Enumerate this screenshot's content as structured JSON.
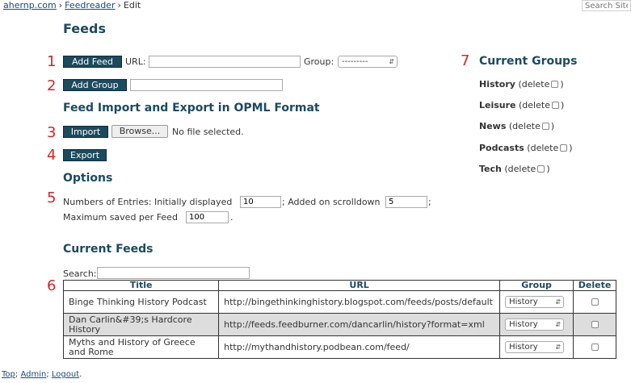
{
  "breadcrumb": {
    "site": "ahernp.com",
    "section": "Feedreader",
    "current": "Edit",
    "separator": "›"
  },
  "site_search": {
    "placeholder": "Search Site"
  },
  "page_title": "Feeds",
  "callouts": [
    "1",
    "2",
    "3",
    "4",
    "5",
    "6",
    "7"
  ],
  "add_feed": {
    "button": "Add Feed",
    "url_label": "URL:",
    "url_value": "",
    "group_label": "Group:",
    "group_value": "---------"
  },
  "add_group": {
    "button": "Add Group",
    "value": ""
  },
  "opml": {
    "heading": "Feed Import and Export in OPML Format",
    "import_button": "Import",
    "browse_button": "Browse...",
    "file_status": "No file selected.",
    "export_button": "Export"
  },
  "options": {
    "heading": "Options",
    "entries_label": "Numbers of Entries: Initially displayed",
    "initial_value": "10",
    "scroll_label": "; Added on scrolldown",
    "scroll_value": "5",
    "scroll_suffix": ";",
    "max_label": "Maximum saved per Feed",
    "max_value": "100",
    "max_suffix": "."
  },
  "current_feeds": {
    "heading": "Current Feeds",
    "search_label": "Search:",
    "search_value": "",
    "columns": [
      "Title",
      "URL",
      "Group",
      "Delete"
    ],
    "rows": [
      {
        "title": "Binge Thinking History Podcast",
        "url": "http://bingethinkinghistory.blogspot.com/feeds/posts/default",
        "group": "History"
      },
      {
        "title": "Dan Carlin&#39;s Hardcore History",
        "url": "http://feeds.feedburner.com/dancarlin/history?format=xml",
        "group": "History"
      },
      {
        "title": "Myths and History of Greece and Rome",
        "url": "http://mythandhistory.podbean.com/feed/",
        "group": "History"
      }
    ]
  },
  "current_groups": {
    "heading": "Current Groups",
    "delete_label": "(delete",
    "close_paren": ")",
    "items": [
      "History",
      "Leisure",
      "News",
      "Podcasts",
      "Tech"
    ]
  },
  "footer": {
    "top": "Top",
    "admin": "Admin",
    "logout": "Logout",
    "sep": ";",
    "end": "."
  },
  "colors": {
    "accent": "#1c4a5e",
    "callout": "#dd2222",
    "row_alt": "#dddddd"
  }
}
